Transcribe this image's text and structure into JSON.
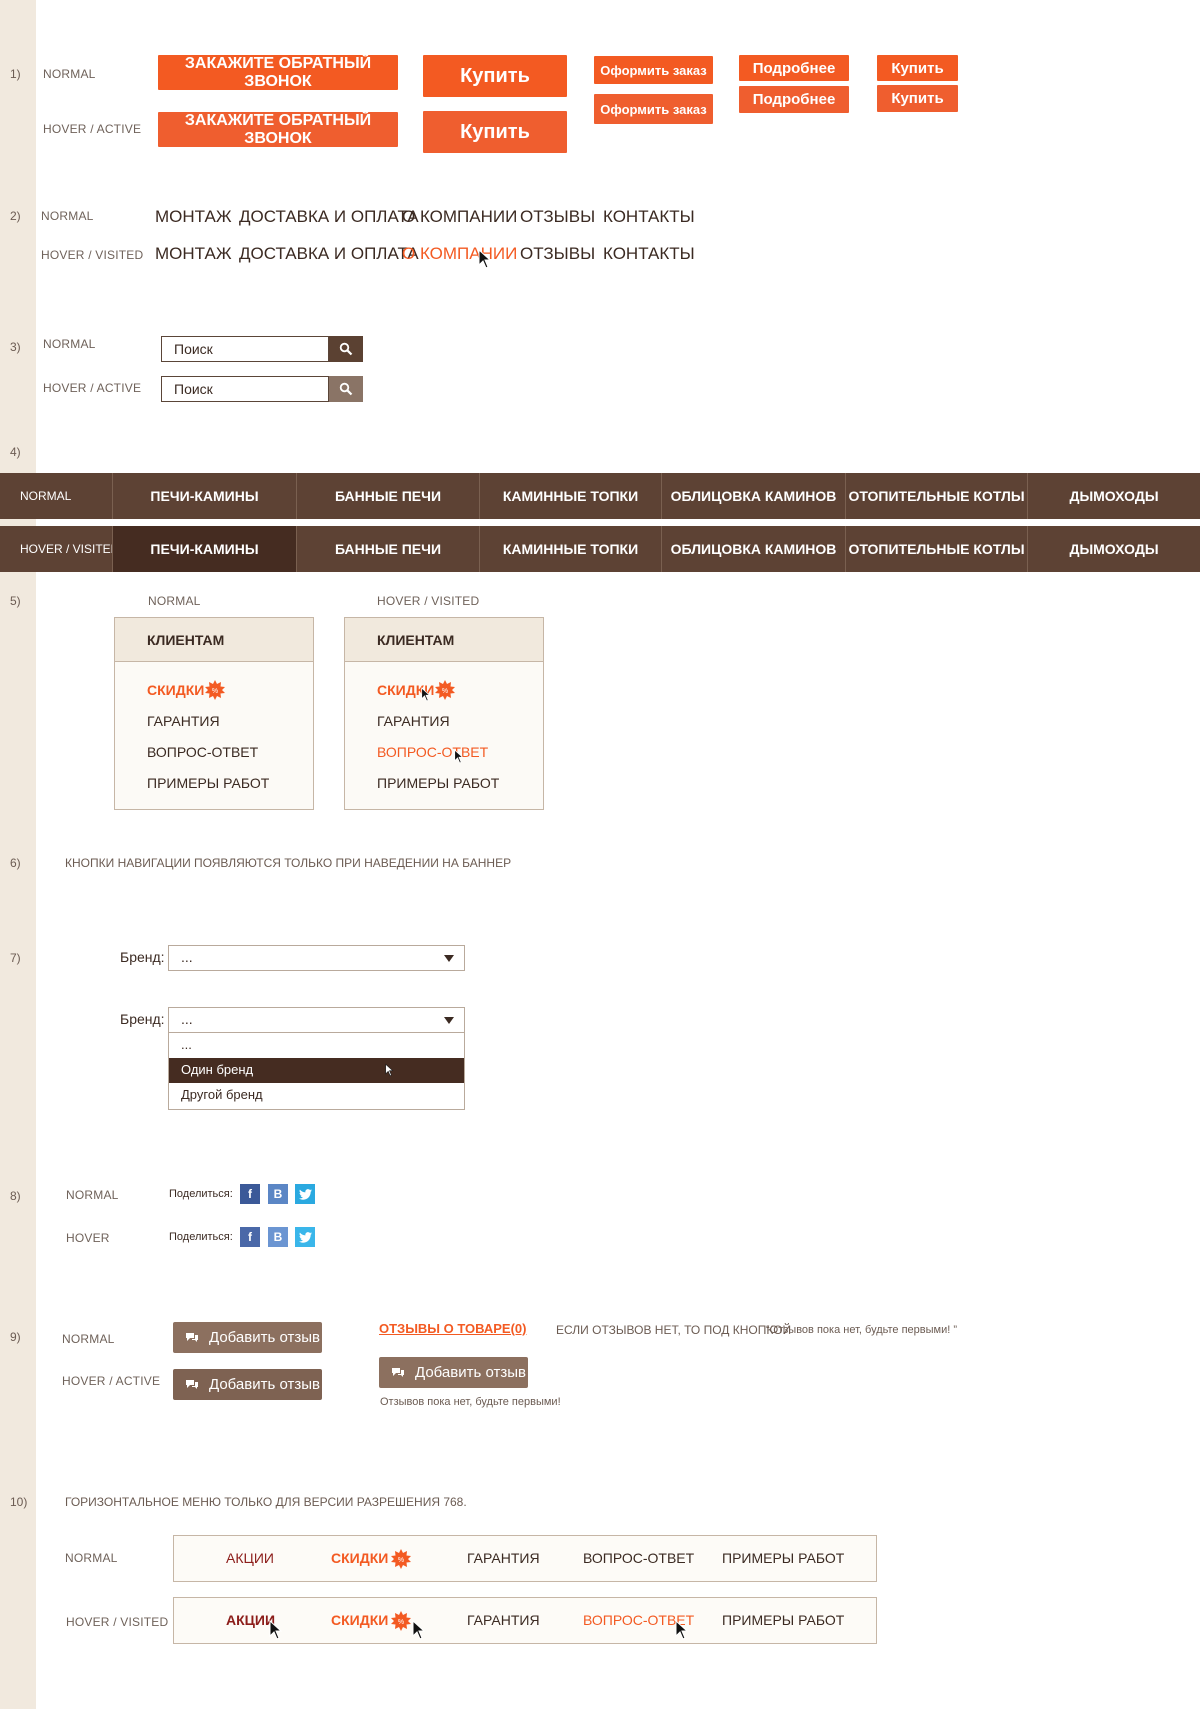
{
  "section_numbers": [
    "1)",
    "2)",
    "3)",
    "4)",
    "5)",
    "6)",
    "7)",
    "8)",
    "9)",
    "10)"
  ],
  "states": {
    "normal": "NORMAL",
    "hover_active": "HOVER / ACTIVE",
    "hover_visited": "HOVER / VISITED",
    "hover": "HOVER"
  },
  "buttons": {
    "call": "ЗАКАЖИТЕ ОБРАТНЫЙ ЗВОНОК",
    "buy": "Купить",
    "order": "Оформить заказ",
    "more": "Подробнее",
    "buy_small": "Купить"
  },
  "top_menu": [
    "МОНТАЖ",
    "ДОСТАВКА И ОПЛАТА",
    "О КОМПАНИИ",
    "ОТЗЫВЫ",
    "КОНТАКТЫ"
  ],
  "search": {
    "placeholder": "Поиск"
  },
  "main_nav": [
    "ПЕЧИ-КАМИНЫ",
    "БАННЫЕ ПЕЧИ",
    "КАМИННЫЕ ТОПКИ",
    "ОБЛИЦОВКА  КАМИНОВ",
    "ОТОПИТЕЛЬНЫЕ КОТЛЫ",
    "ДЫМОХОДЫ"
  ],
  "dropdown": {
    "title": "КЛИЕНТАМ",
    "items": [
      "СКИДКИ",
      "ГАРАНТИЯ",
      "ВОПРОС-ОТВЕТ",
      "ПРИМЕРЫ РАБОТ"
    ],
    "badge": "%"
  },
  "note6": "КНОПКИ НАВИГАЦИИ ПОЯВЛЯЮТСЯ ТОЛЬКО ПРИ НАВЕДЕНИИ НА БАННЕР",
  "brand_select": {
    "label": "Бренд:",
    "value": "...",
    "options": [
      "...",
      "Один бренд",
      "Другой бренд"
    ]
  },
  "share": {
    "label": "Поделиться:",
    "icons": [
      "f",
      "В"
    ]
  },
  "reviews": {
    "add_button": "Добавить отзыв",
    "link": "ОТЗЫВЫ О ТОВАРЕ(0)",
    "note": "ЕСЛИ ОТЗЫВОВ НЕТ, ТО ПОД КНОПКОЙ",
    "quote": "“Отзывов пока нет, будьте первыми! ”",
    "empty": "Отзывов пока нет, будьте первыми!"
  },
  "note10": "ГОРИЗОНТАЛЬНОЕ МЕНЮ ТОЛЬКО ДЛЯ ВЕРСИИ РАЗРЕШЕНИЯ 768.",
  "hmenu": [
    "АКЦИИ",
    "СКИДКИ",
    "ГАРАНТИЯ",
    "ВОПРОС-ОТВЕТ",
    "ПРИМЕРЫ РАБОТ"
  ],
  "colors": {
    "accent": "#f35a22",
    "brown": "#5d4234",
    "dark_brown": "#452c21",
    "beige": "#f1e9de",
    "facebook": "#3b5998",
    "vk": "#5b86c5",
    "twitter": "#2aa9e0"
  }
}
